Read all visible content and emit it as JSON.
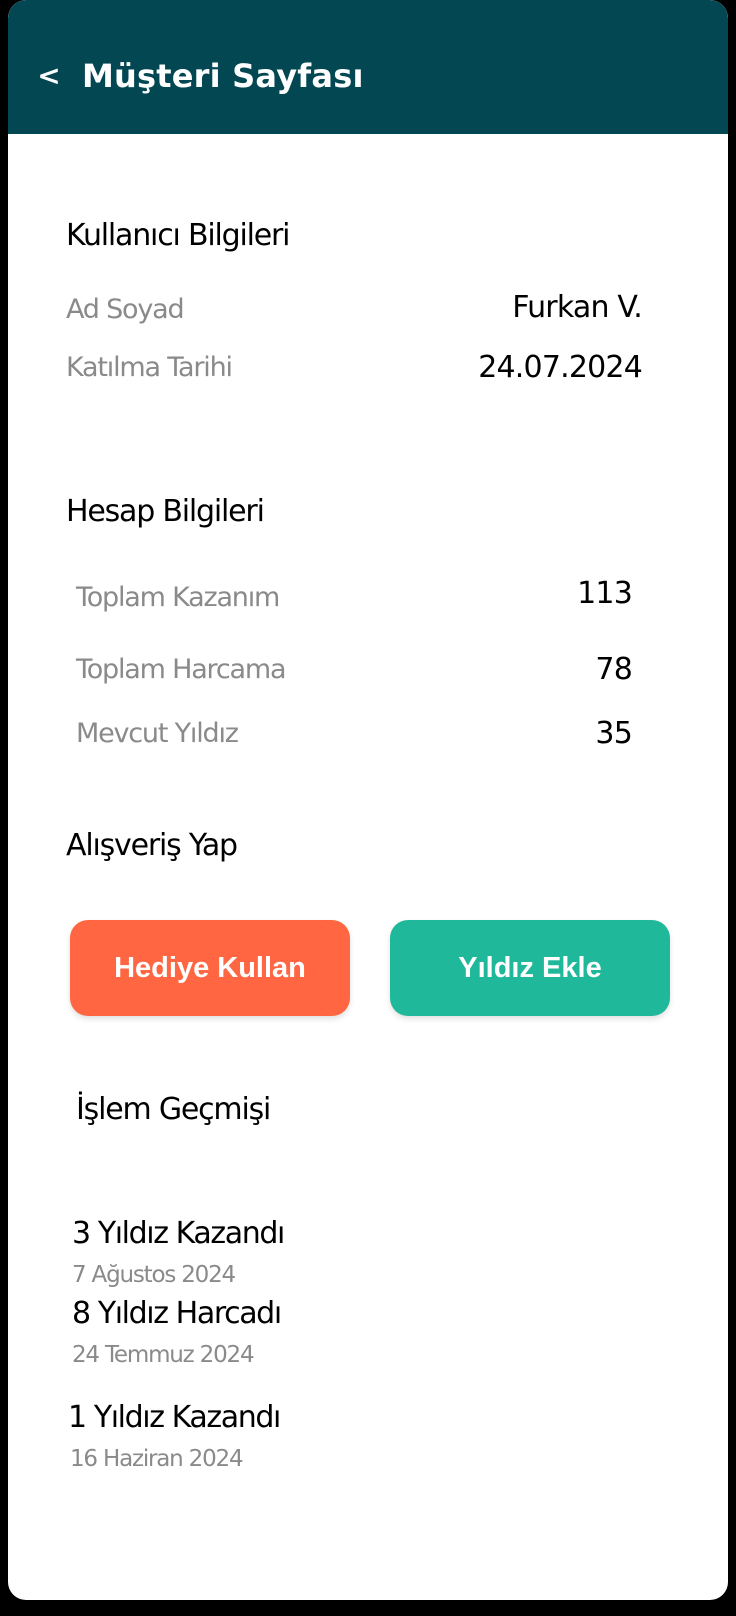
{
  "header": {
    "back_label": "<",
    "title": "Müşteri Sayfası"
  },
  "user_info": {
    "title": "Kullanıcı Bilgileri",
    "rows": [
      {
        "label": "Ad Soyad",
        "value": "Furkan V."
      },
      {
        "label": "Katılma Tarihi",
        "value": "24.07.2024"
      }
    ]
  },
  "account_info": {
    "title": "Hesap Bilgileri",
    "rows": [
      {
        "label": "Toplam Kazanım",
        "value": "113"
      },
      {
        "label": "Toplam Harcama",
        "value": "78"
      },
      {
        "label": "Mevcut Yıldız",
        "value": "35"
      }
    ]
  },
  "shopping": {
    "title": "Alışveriş Yap",
    "gift_button": "Hediye Kullan",
    "add_star_button": "Yıldız Ekle"
  },
  "history": {
    "title": "İşlem Geçmişi",
    "items": [
      {
        "title": "3 Yıldız Kazandı",
        "date": "7 Ağustos 2024"
      },
      {
        "title": "8 Yıldız Harcadı",
        "date": "24 Temmuz 2024"
      },
      {
        "title": "1 Yıldız Kazandı",
        "date": "16 Haziran 2024"
      }
    ]
  },
  "colors": {
    "header_bg": "#024752",
    "gift_button_bg": "#ff6641",
    "add_star_button_bg": "#1fb89b"
  }
}
